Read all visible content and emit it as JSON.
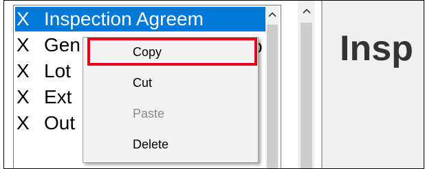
{
  "list": {
    "items": [
      {
        "mark": "X",
        "label": "Inspection Agreem",
        "selected": true
      },
      {
        "mark": "X",
        "label": "Gen",
        "tail": "o",
        "selected": false
      },
      {
        "mark": "X",
        "label": "Lot",
        "selected": false
      },
      {
        "mark": "X",
        "label": "Ext",
        "selected": false
      },
      {
        "mark": "X",
        "label": "Out",
        "selected": false
      }
    ]
  },
  "detail": {
    "heading": "Insp"
  },
  "context_menu": {
    "items": [
      {
        "label": "Copy",
        "enabled": true,
        "highlighted": true
      },
      {
        "label": "Cut",
        "enabled": true
      },
      {
        "label": "Paste",
        "enabled": false
      },
      {
        "label": "Delete",
        "enabled": true
      }
    ]
  },
  "colors": {
    "selection": "#0078d7",
    "highlight_box": "#e3001b"
  },
  "icons": {
    "scroll_up": "chevron-up-icon"
  }
}
